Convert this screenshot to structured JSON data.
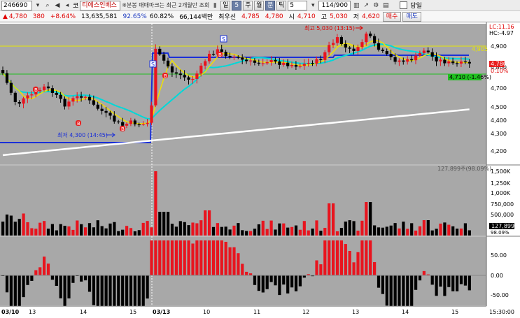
{
  "toolbar": {
    "code": "246690",
    "market_prefix": "코",
    "name": "티에스인베스",
    "marker_text": "※분봉 매매마크는 최근 2개월만 조회",
    "periods": [
      "일",
      "5",
      "주",
      "월",
      "분",
      "틱"
    ],
    "interval_value": "5",
    "count": "114/900",
    "same_day_label": "당일",
    "icons": [
      "dropdown-arrow",
      "search-icon",
      "speaker-icon",
      "left-arrow",
      "right-arrow",
      "lock-icon",
      "bar-icon",
      "arrow-icon",
      "gear-icon",
      "layout-icon"
    ]
  },
  "quote": {
    "price": "4,780",
    "change": "380",
    "rate": "+8.64%",
    "volume": "13,635,581",
    "vol_pct": "92.65%",
    "turnover_pct": "60.82%",
    "amount": "66,144백만",
    "best_label": "최우선",
    "ask": "4,785",
    "bid": "4,780",
    "open_label": "시",
    "open": "4,710",
    "high_label": "고",
    "high": "5,030",
    "low_label": "저",
    "low": "4,620",
    "buy_label": "매수",
    "sell_label": "매도"
  },
  "chart": {
    "lc_label": "LC:11.16",
    "hc_label": "HC:-4.97",
    "high_annot": "최고 5,030 (13:15)",
    "low_annot": "최저 4,300 (14:45)",
    "line_4905": "4,905",
    "line_4710": "4,710 (-1.46%)",
    "cur_price": "4,780",
    "cur_pct": "0.10%",
    "price_ticks": [
      "4,900",
      "4,800",
      "4,700",
      "4,500",
      "4,400",
      "4,300",
      "4,200"
    ],
    "volume_annot": "127,899주(98.09%)",
    "volume_ticks": [
      "1,500K",
      "1,250K",
      "1,000K",
      "750,000",
      "500,000",
      "98.09%"
    ],
    "volume_current": "127,899",
    "osc_ticks": [
      "50.00",
      "0.00",
      "-50.00"
    ],
    "date_labels": [
      "03/10",
      "13",
      "14",
      "15",
      "03/13",
      "10",
      "11",
      "12",
      "13",
      "14",
      "15"
    ],
    "time_label": "15:30:00",
    "signal_S": "S",
    "signal_B": "B"
  },
  "colors": {
    "up": "#e8141e",
    "down": "#000000",
    "bg": "#a8a8a8",
    "ma5": "#f0e000",
    "ma20": "#00d8d8",
    "ma60": "#ffffff",
    "ref_line": "#1a2fd8"
  }
}
